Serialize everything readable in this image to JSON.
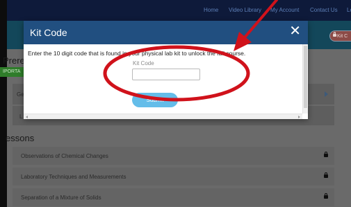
{
  "topnav": {
    "links": [
      "Home",
      "Video Library",
      "My Account",
      "Contact Us",
      "Lo"
    ]
  },
  "header": {
    "kit_button_label": "Kit C"
  },
  "page": {
    "prereq_heading": "Prereq",
    "tag": "IPORTA",
    "prereq_rows": [
      "Ge",
      "L"
    ],
    "lessons_heading": "essons",
    "lessons": [
      "Observations of Chemical Changes",
      "Laboratory Techniques and Measurements",
      "Separation of a Mixture of Solids"
    ]
  },
  "modal": {
    "title": "Kit Code",
    "close_glyph": "✕",
    "instructions": "Enter the 10 digit code that is found in your physical lab kit to unlock the full course.",
    "field_label": "Kit Code",
    "input_value": "",
    "submit_label": "Submit"
  },
  "colors": {
    "modal_header": "#214f80",
    "submit": "#64bde9",
    "annotation": "#d0121b"
  },
  "icons": [
    "close-icon",
    "lock-icon",
    "chevron-right-icon",
    "arrow-annotation",
    "ellipse-annotation"
  ]
}
